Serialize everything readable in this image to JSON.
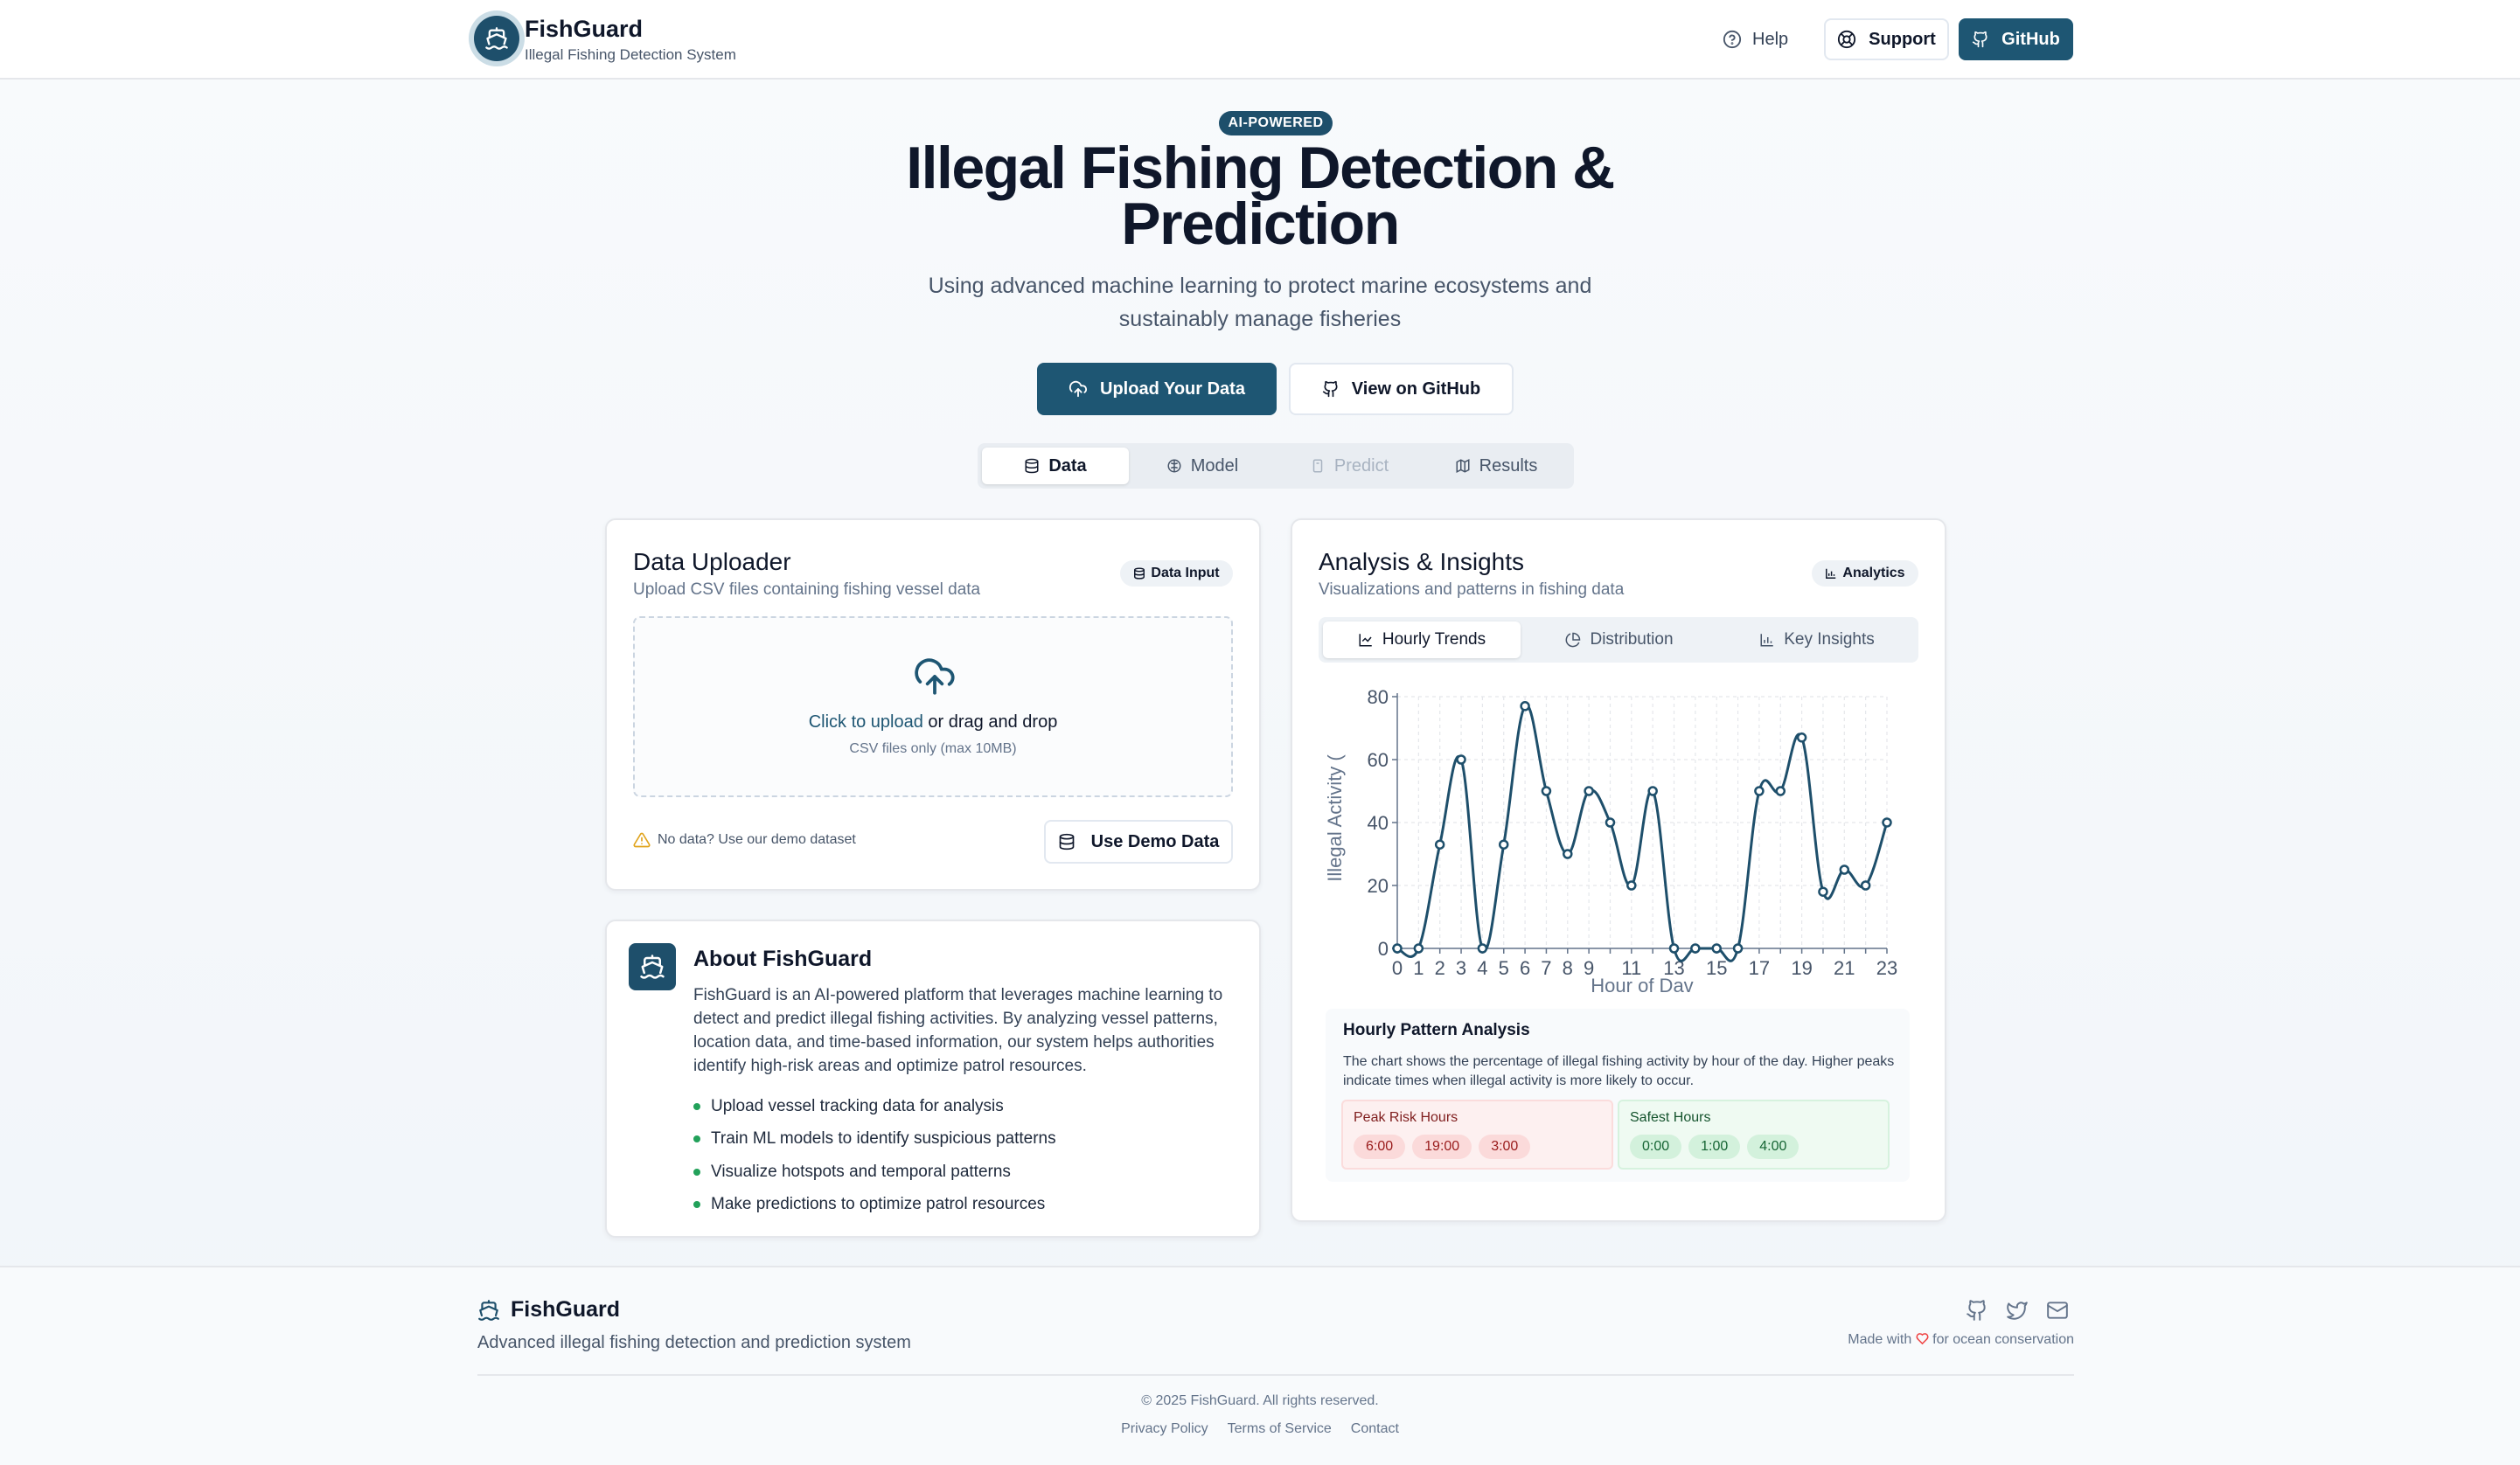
{
  "header": {
    "brand_name": "FishGuard",
    "brand_subtitle": "Illegal Fishing Detection System",
    "help_label": "Help",
    "support_label": "Support",
    "github_label": "GitHub"
  },
  "hero": {
    "pill": "AI-POWERED",
    "title": "Illegal Fishing Detection & Prediction",
    "subtitle": "Using advanced machine learning to protect marine ecosystems and sustainably manage fisheries",
    "upload_button": "Upload Your Data",
    "github_button": "View on GitHub"
  },
  "tabs": [
    {
      "label": "Data",
      "icon": "database-icon",
      "state": "active"
    },
    {
      "label": "Model",
      "icon": "brain-icon",
      "state": "normal"
    },
    {
      "label": "Predict",
      "icon": "file-icon",
      "state": "disabled"
    },
    {
      "label": "Results",
      "icon": "map-icon",
      "state": "normal"
    }
  ],
  "uploader": {
    "title": "Data Uploader",
    "subtitle": "Upload CSV files containing fishing vessel data",
    "chip": "Data Input",
    "click_link": "Click to upload",
    "drag_text": " or drag and drop",
    "hint": "CSV files only (max 10MB)",
    "demo_note": "No data? Use our demo dataset",
    "demo_button": "Use Demo Data"
  },
  "about": {
    "title": "About FishGuard",
    "description": "FishGuard is an AI-powered platform that leverages machine learning to detect and predict illegal fishing activities. By analyzing vessel patterns, location data, and time-based information, our system helps authorities identify high-risk areas and optimize patrol resources.",
    "bullets": [
      "Upload vessel tracking data for analysis",
      "Train ML models to identify suspicious patterns",
      "Visualize hotspots and temporal patterns",
      "Make predictions to optimize patrol resources"
    ]
  },
  "analysis": {
    "title": "Analysis & Insights",
    "subtitle": "Visualizations and patterns in fishing data",
    "chip": "Analytics",
    "subtabs": [
      {
        "label": "Hourly Trends",
        "icon": "line-chart-icon"
      },
      {
        "label": "Distribution",
        "icon": "pie-chart-icon"
      },
      {
        "label": "Key Insights",
        "icon": "bar-chart-icon"
      }
    ],
    "pattern_title": "Hourly Pattern Analysis",
    "pattern_desc": "The chart shows the percentage of illegal fishing activity by hour of the day. Higher peaks indicate times when illegal activity is more likely to occur.",
    "peak_label": "Peak Risk Hours",
    "peak_hours": [
      "6:00",
      "19:00",
      "3:00"
    ],
    "safe_label": "Safest Hours",
    "safe_hours": [
      "0:00",
      "1:00",
      "4:00"
    ]
  },
  "chart_data": {
    "type": "line",
    "xlabel": "Hour of Dav",
    "ylabel": "Illegal Activity (",
    "x": [
      0,
      1,
      2,
      3,
      4,
      5,
      6,
      7,
      8,
      9,
      10,
      11,
      12,
      13,
      14,
      15,
      16,
      17,
      18,
      19,
      20,
      21,
      22,
      23
    ],
    "x_ticks": [
      0,
      1,
      2,
      3,
      4,
      5,
      6,
      7,
      8,
      9,
      11,
      13,
      15,
      17,
      19,
      21,
      23
    ],
    "y_ticks": [
      0,
      20,
      40,
      60,
      80
    ],
    "ylim": [
      0,
      80
    ],
    "xlim": [
      0,
      23
    ],
    "grid": true,
    "line_color": "#1e4f6b",
    "series": [
      {
        "values": [
          0,
          0,
          33,
          60,
          0,
          33,
          77,
          50,
          30,
          50,
          40,
          20,
          50,
          0,
          0,
          0,
          0,
          50,
          50,
          67,
          18,
          25,
          20,
          40
        ]
      }
    ]
  },
  "footer": {
    "brand": "FishGuard",
    "subtitle": "Advanced illegal fishing detection and prediction system",
    "made_prefix": "Made with",
    "made_suffix": "for ocean conservation",
    "copyright": "© 2025 FishGuard. All rights reserved.",
    "links": [
      "Privacy Policy",
      "Terms of Service",
      "Contact"
    ],
    "icons": [
      "github-icon",
      "twitter-icon",
      "mail-icon"
    ]
  }
}
